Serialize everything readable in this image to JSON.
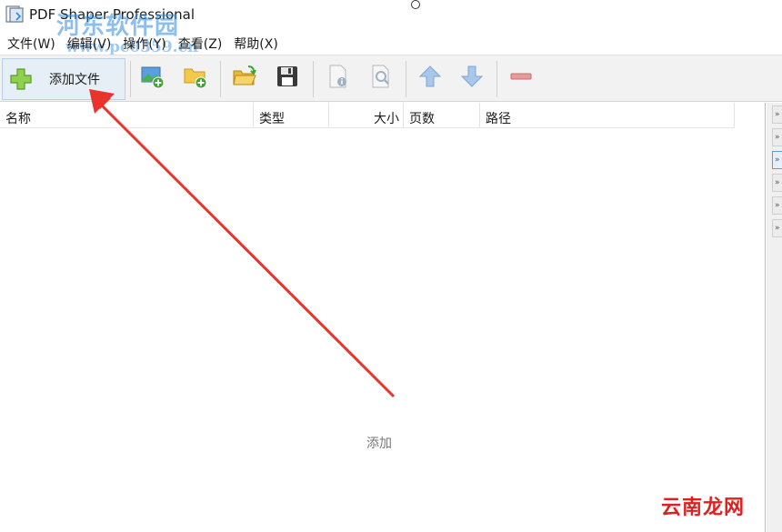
{
  "window": {
    "title": "PDF Shaper Professional"
  },
  "watermark": {
    "site_name": "河东软件园",
    "url": "www.pc0359.cn",
    "corner_text": "云南龙网"
  },
  "menu": [
    "文件(W)",
    "编辑(V)",
    "操作(Y)",
    "查看(Z)",
    "帮助(X)"
  ],
  "toolbar": {
    "add_file_label": "添加文件",
    "icons": [
      "add-image-icon",
      "add-folder-icon",
      "open-folder-icon",
      "save-icon",
      "document-info-icon",
      "document-search-icon",
      "move-up-icon",
      "move-down-icon",
      "remove-icon"
    ]
  },
  "table": {
    "columns": [
      "名称",
      "类型",
      "大小",
      "页数",
      "路径"
    ],
    "rows": [],
    "empty_hint": "添加"
  },
  "colors": {
    "arrow": "#e8342a",
    "accent_blue": "#5a9fd8",
    "plus_green": "#7cc23a"
  }
}
